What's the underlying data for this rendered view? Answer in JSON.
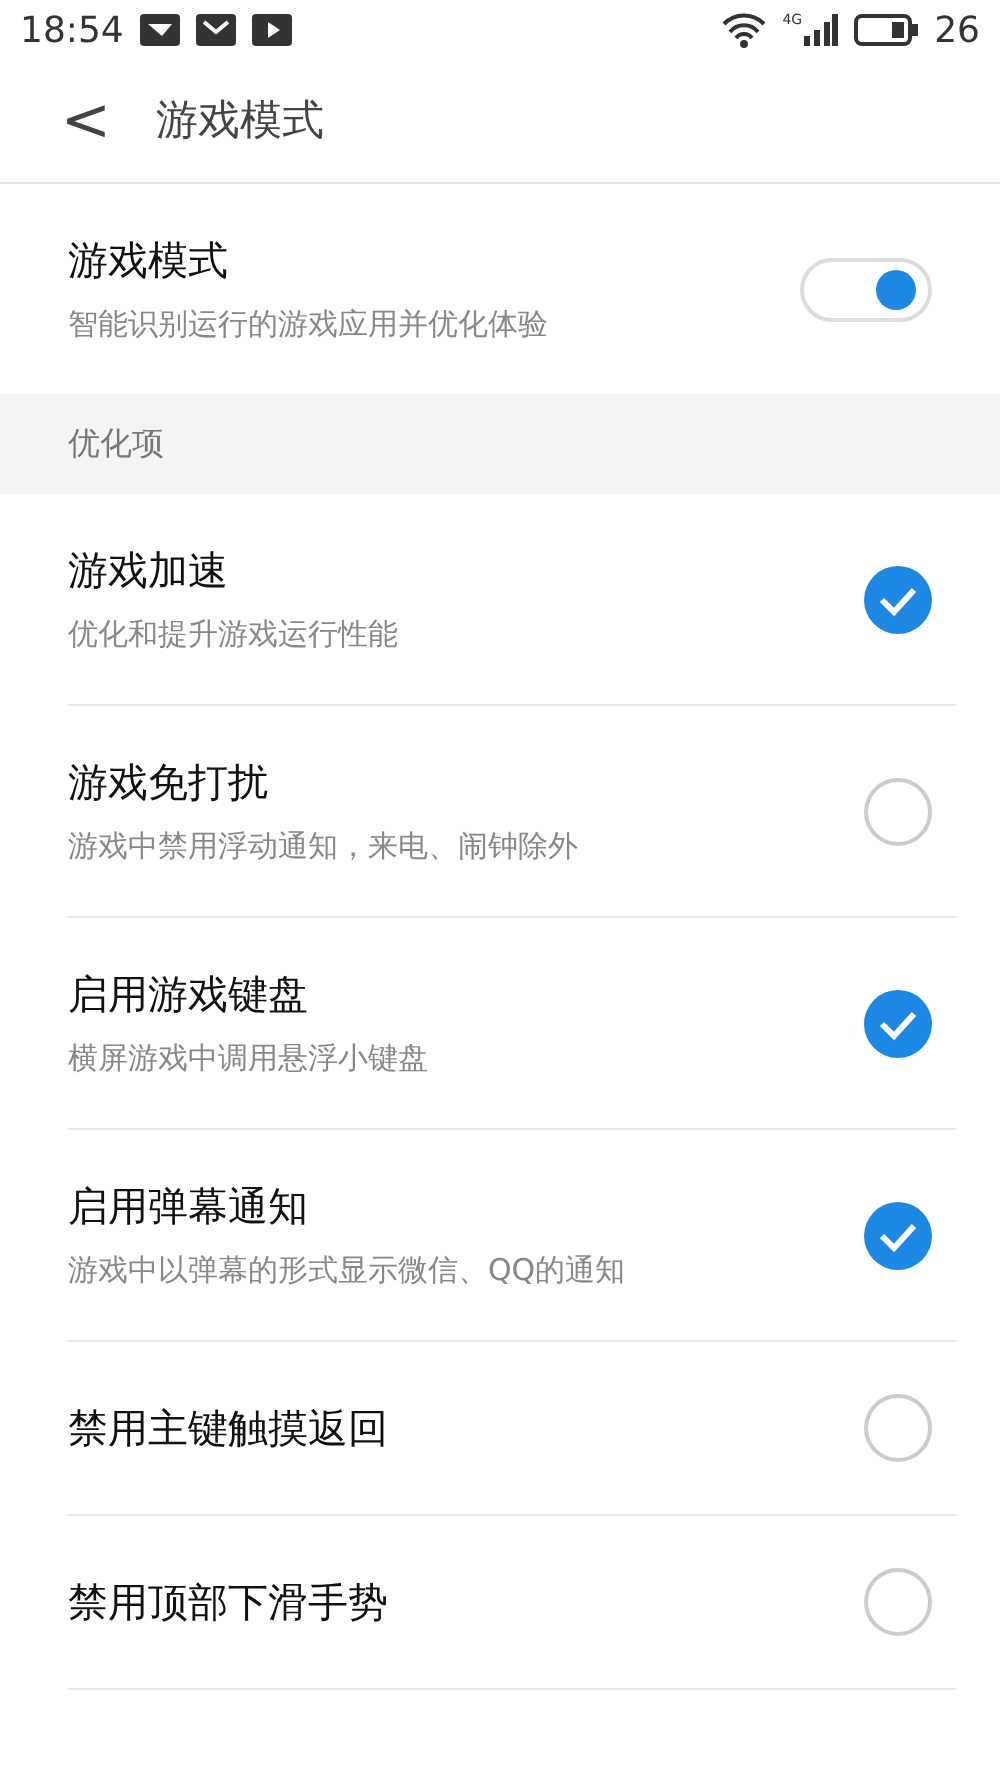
{
  "status_bar": {
    "time": "18:54",
    "network": "4G",
    "battery": "26"
  },
  "header": {
    "back": "<",
    "title": "游戏模式"
  },
  "game_mode": {
    "title": "游戏模式",
    "subtitle": "智能识别运行的游戏应用并优化体验",
    "on": true
  },
  "section": {
    "title": "优化项"
  },
  "options": [
    {
      "title": "游戏加速",
      "subtitle": "优化和提升游戏运行性能",
      "checked": true
    },
    {
      "title": "游戏免打扰",
      "subtitle": "游戏中禁用浮动通知，来电、闹钟除外",
      "checked": false
    },
    {
      "title": "启用游戏键盘",
      "subtitle": "横屏游戏中调用悬浮小键盘",
      "checked": true
    },
    {
      "title": "启用弹幕通知",
      "subtitle": "游戏中以弹幕的形式显示微信、QQ的通知",
      "checked": true
    },
    {
      "title": "禁用主键触摸返回",
      "checked": false
    },
    {
      "title": "禁用顶部下滑手势",
      "checked": false
    }
  ]
}
